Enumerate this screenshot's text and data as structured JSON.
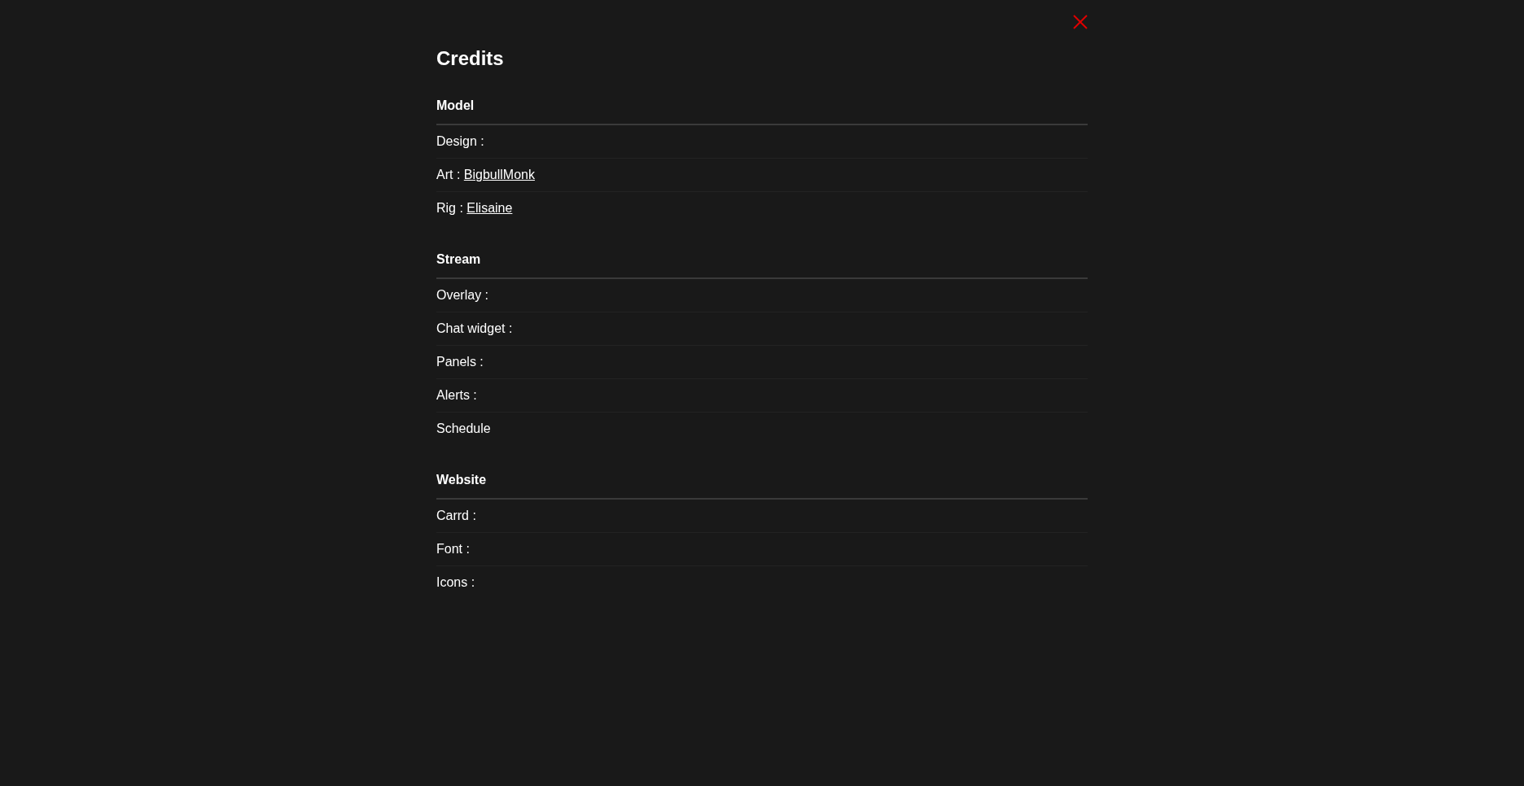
{
  "title": "Credits",
  "sections": [
    {
      "heading": "Model",
      "rows": [
        {
          "label": "Design :"
        },
        {
          "label": "Art :",
          "link": "BigbullMonk"
        },
        {
          "label": "Rig :",
          "link": "Elisaine"
        }
      ]
    },
    {
      "heading": "Stream",
      "rows": [
        {
          "label": "Overlay :"
        },
        {
          "label": "Chat widget :"
        },
        {
          "label": "Panels :"
        },
        {
          "label": "Alerts :"
        },
        {
          "label": "Schedule"
        }
      ]
    },
    {
      "heading": "Website",
      "rows": [
        {
          "label": "Carrd :"
        },
        {
          "label": "Font :"
        },
        {
          "label": "Icons :"
        }
      ]
    }
  ]
}
